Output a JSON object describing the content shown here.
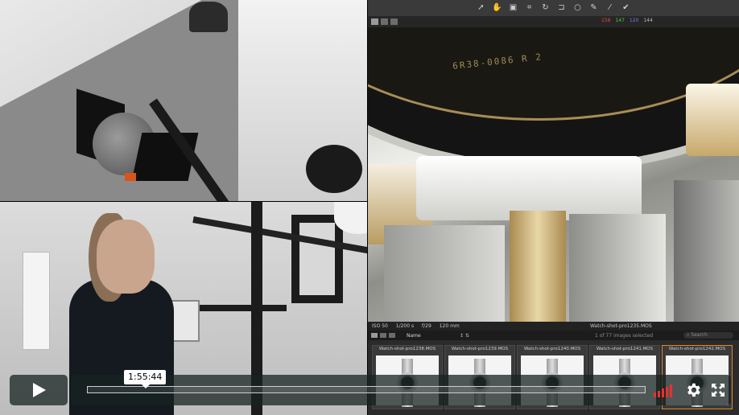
{
  "player": {
    "time_tooltip": "1:55:44",
    "progress_fraction": 0.0,
    "volume_bars": 5,
    "colors": {
      "background": "#172322",
      "accent_volume": "#e8312f"
    }
  },
  "app": {
    "levels": {
      "r": "158",
      "g": "147",
      "b": "120",
      "k": "144"
    },
    "engraving": "6R38-0086 R 2",
    "info": {
      "iso": "ISO 50",
      "shutter": "1/200 s",
      "aperture": "f/29",
      "focal": "120 mm",
      "filename": "Watch-shot-pro1235.MOS"
    },
    "browser": {
      "sort_label": "Name",
      "count_text": "1 of 77 images selected",
      "search_placeholder": "Search"
    },
    "thumbnails": [
      {
        "name": "Watch-shot-pro1238.MOS"
      },
      {
        "name": "Watch-shot-pro1239.MOS"
      },
      {
        "name": "Watch-shot-pro1240.MOS"
      },
      {
        "name": "Watch-shot-pro1241.MOS"
      },
      {
        "name": "Watch-shot-pro1242.MOS"
      }
    ],
    "tools": [
      "cursor-icon",
      "pan-icon",
      "loupe-icon",
      "crop-icon",
      "rotate-icon",
      "straighten-icon",
      "spot-icon",
      "picker-icon",
      "brush-icon",
      "checkmark-icon"
    ],
    "colors": {
      "accent": "#f59b27",
      "r": "#e04a4a",
      "g": "#56c256",
      "b": "#6f7ff0",
      "k": "#bbbbbb"
    }
  }
}
